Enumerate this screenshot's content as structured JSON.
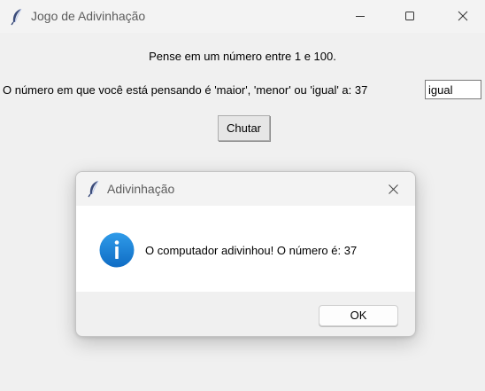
{
  "window": {
    "title": "Jogo de Adivinhação",
    "icon": "feather-icon",
    "controls": [
      "minimize-icon",
      "maximize-icon",
      "close-icon"
    ]
  },
  "main": {
    "prompt": "Pense em um número entre 1 e 100.",
    "question": "O número em que você está pensando é 'maior', 'menor' ou 'igual' a: 37",
    "answer_value": "igual",
    "guess_button": "Chutar"
  },
  "dialog": {
    "title": "Adivinhação",
    "icon": "feather-icon",
    "message_icon": "info-icon",
    "message": "O computador adivinhou! O número é: 37",
    "ok_button": "OK",
    "accent": "#1a7fd8"
  }
}
